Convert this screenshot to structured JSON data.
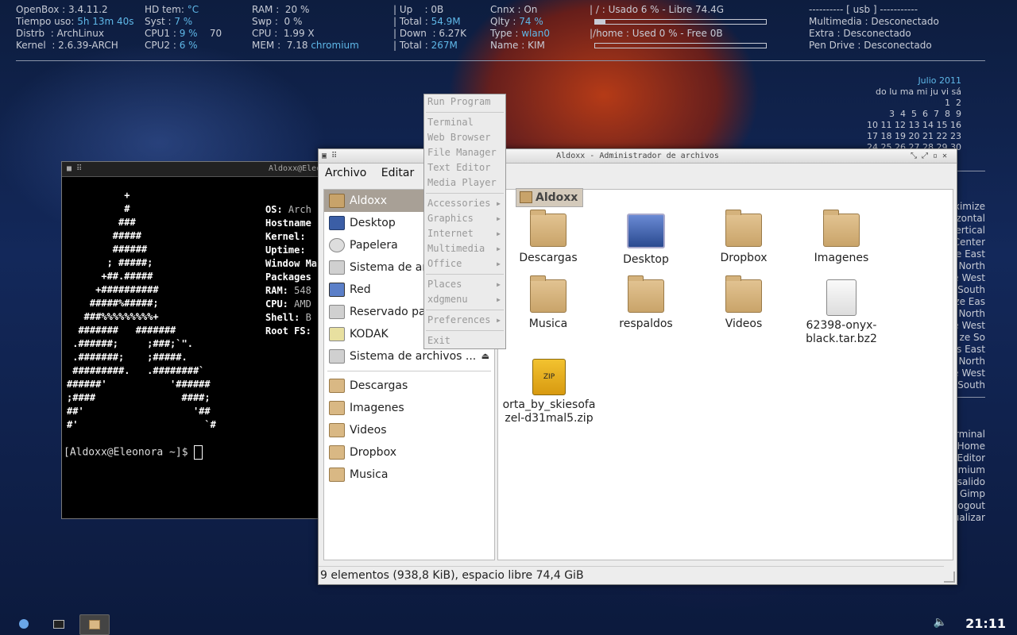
{
  "conky": {
    "col1": [
      "OpenBox : 3.4.11.2",
      "Tiempo uso: ",
      "Distrb  : ArchLinux",
      "Kernel  : 2.6.39-ARCH"
    ],
    "uptime": "5h 13m 40s",
    "col2": [
      "HD tem: ",
      "Syst : ",
      "CPU1 : ",
      "CPU2 : "
    ],
    "col2_vals": [
      "°C",
      "7 %",
      "9 %",
      "6 %"
    ],
    "cpu1_extra": "70",
    "col3": [
      "RAM :  20 %",
      "Swp :  0 %",
      "CPU :  1.99 X",
      "MEM :  7.18 "
    ],
    "mem_proc": "chromium",
    "col4": [
      "| Up    : 0B",
      "| Total : ",
      "| Down  : 6.27K",
      "| Total : "
    ],
    "col4_vals": [
      "54.9M",
      "267M"
    ],
    "col5": [
      "Cnnx : On",
      "Qlty : ",
      "Type : ",
      "Name : KIM"
    ],
    "col5_vals": [
      "74 %",
      "wlan0"
    ],
    "root_fs": "/ : Usado 6 % - Libre 74.4G",
    "home_fs": "/home : Used 0 % - Free 0B",
    "root_usage": 0.06,
    "home_usage": 0.0,
    "usb_header": "---------- [ usb ] -----------",
    "usb": [
      "Multimedia : Desconectado",
      "Extra : Desconectado",
      "Pen Drive : Desconectado"
    ]
  },
  "calendar": {
    "month": "Julio 2011",
    "header": "do lu ma mi ju vi sá",
    "rows": [
      "1  2",
      "3  4  5  6  7  8  9",
      "10 11 12 13 14 15 16",
      "17 18 19 20 21 22 23",
      "24 25 26 27 28 29 30"
    ]
  },
  "keybind_list": [
    "ximize",
    "zontal",
    "ertical",
    "Center",
    "e East",
    "North",
    "e West",
    "South",
    "ze Eas",
    "North",
    "e West",
    "ze So",
    "s East",
    "North",
    "e West",
    "South"
  ],
  "launch_list": [
    "rminal",
    "Home",
    "Editor",
    "mium",
    "salido",
    "Gimp",
    "ogout",
    "ualizar"
  ],
  "terminal": {
    "title": "Aldoxx@Eleonora",
    "ascii": "          +\n          #\n         ###\n        #####\n        ######\n       ; #####;\n      +##.#####\n     +##########\n    #####%#####;\n   ###%%%%%%%%%+\n  #######   #######\n .######;     ;###;`\".\n .#######;    ;#####.\n #########.   .########`\n######'           '######\n;####               ####;\n##'                   '##\n#'                      `#",
    "info_labels": [
      "OS: ",
      "Hostname",
      "Kernel: ",
      "Uptime: ",
      "Window Ma",
      "Packages",
      "RAM: ",
      "CPU: ",
      "Shell: ",
      "Root FS: "
    ],
    "info_values": [
      "Arch",
      "",
      "",
      "",
      "",
      "",
      "548",
      "AMD",
      "B",
      ""
    ],
    "prompt": "[Aldoxx@Eleonora ~]$ "
  },
  "filemanager": {
    "title": "Aldoxx - Administrador de archivos",
    "menu": [
      "Archivo",
      "Editar",
      "V"
    ],
    "sidebar": [
      "Aldoxx",
      "Desktop",
      "Papelera",
      "Sistema de arc",
      "Red",
      "Reservado par",
      "KODAK",
      "Sistema de archivos ..."
    ],
    "bookmarks": [
      "Descargas",
      "Imagenes",
      "Videos",
      "Dropbox",
      "Musica"
    ],
    "path": "Aldoxx",
    "items": [
      "Descargas",
      "Desktop",
      "Dropbox",
      "Imagenes",
      "Musica",
      "respaldos",
      "Videos",
      "62398-onyx-\nblack.tar.bz2",
      "orta_by_skiesofa\nzel-d31mal5.zip"
    ],
    "zip_label": "ZIP",
    "status": "9 elementos (938,8 KiB), espacio libre 74,4 GiB"
  },
  "menu": {
    "top": "Run Program",
    "apps": [
      "Terminal",
      "Web Browser",
      "File Manager",
      "Text Editor",
      "Media Player"
    ],
    "cats": [
      "Accessories",
      "Graphics",
      "Internet",
      "Multimedia",
      "Office"
    ],
    "places": [
      "Places",
      "xdgmenu"
    ],
    "prefs": "Preferences",
    "exit": "Exit"
  },
  "taskbar": {
    "clock": "21:11"
  }
}
